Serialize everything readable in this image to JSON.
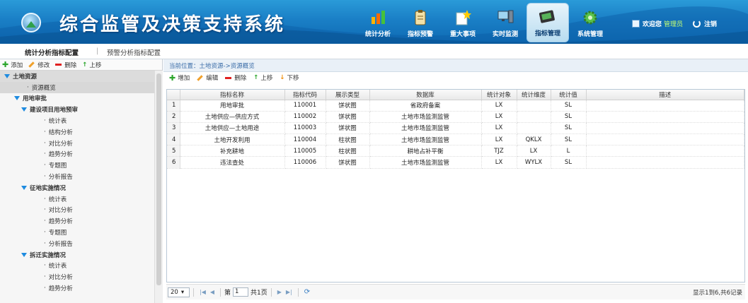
{
  "header": {
    "title": "综合监管及决策支持系统",
    "nav": [
      {
        "label": "统计分析",
        "icon": "bar-chart-icon"
      },
      {
        "label": "指标预警",
        "icon": "clipboard-icon"
      },
      {
        "label": "重大事项",
        "icon": "note-star-icon"
      },
      {
        "label": "实时监测",
        "icon": "monitor-icon"
      },
      {
        "label": "指标管理",
        "icon": "settings-panel-icon",
        "active": true
      },
      {
        "label": "系统管理",
        "icon": "gear-icon"
      }
    ],
    "welcome": "欢迎您",
    "username": "管理员",
    "logout": "注销"
  },
  "tabs": {
    "tab1": "统计分析指标配置",
    "sep": "|",
    "tab2": "预警分析指标配置"
  },
  "sidebar": {
    "toolbar": {
      "add": "添加",
      "edit": "修改",
      "delete": "删除",
      "up": "上移"
    },
    "tree": [
      {
        "label": "土地资源",
        "level": "l0",
        "arrow": true
      },
      {
        "label": "资源概览",
        "level": "leaf2",
        "selected": true
      },
      {
        "label": "用地审批",
        "level": "l1",
        "arrow": true
      },
      {
        "label": "建设项目用地预审",
        "level": "l2",
        "arrow": true
      },
      {
        "label": "统计表",
        "level": "leaf"
      },
      {
        "label": "结构分析",
        "level": "leaf"
      },
      {
        "label": "对比分析",
        "level": "leaf"
      },
      {
        "label": "趋势分析",
        "level": "leaf"
      },
      {
        "label": "专题图",
        "level": "leaf"
      },
      {
        "label": "分析报告",
        "level": "leaf"
      },
      {
        "label": "征地实施情况",
        "level": "l2",
        "arrow": true
      },
      {
        "label": "统计表",
        "level": "leaf"
      },
      {
        "label": "对比分析",
        "level": "leaf"
      },
      {
        "label": "趋势分析",
        "level": "leaf"
      },
      {
        "label": "专题图",
        "level": "leaf"
      },
      {
        "label": "分析报告",
        "level": "leaf"
      },
      {
        "label": "拆迁实施情况",
        "level": "l2",
        "arrow": true
      },
      {
        "label": "统计表",
        "level": "leaf"
      },
      {
        "label": "对比分析",
        "level": "leaf"
      },
      {
        "label": "趋势分析",
        "level": "leaf"
      }
    ]
  },
  "main": {
    "breadcrumb": "当前位置：土地资源->资源概览",
    "toolbar": {
      "add": "增加",
      "edit": "编辑",
      "delete": "删除",
      "up": "上移",
      "down": "下移"
    },
    "columns": [
      "",
      "指标名称",
      "指标代码",
      "展示类型",
      "数据库",
      "统计对象",
      "统计维度",
      "统计值",
      "描述"
    ],
    "rows": [
      [
        "1",
        "用地审批",
        "110001",
        "饼状图",
        "省政府备案",
        "LX",
        "",
        "SL",
        ""
      ],
      [
        "2",
        "土地供应—供应方式",
        "110002",
        "饼状图",
        "土地市场监测监管",
        "LX",
        "",
        "SL",
        ""
      ],
      [
        "3",
        "土地供应—土地用途",
        "110003",
        "饼状图",
        "土地市场监测监管",
        "LX",
        "",
        "SL",
        ""
      ],
      [
        "4",
        "土地开发利用",
        "110004",
        "柱状图",
        "土地市场监测监管",
        "LX",
        "QKLX",
        "SL",
        ""
      ],
      [
        "5",
        "补充耕地",
        "110005",
        "柱状图",
        "耕地占补平衡",
        "TJZ",
        "LX",
        "L",
        ""
      ],
      [
        "6",
        "违法查处",
        "110006",
        "饼状图",
        "土地市场监测监管",
        "LX",
        "WYLX",
        "SL",
        ""
      ]
    ],
    "pager": {
      "page_size": "20",
      "page_prefix": "第",
      "page_value": "1",
      "page_total": "共1页",
      "info": "显示1到6,共6记录"
    }
  }
}
